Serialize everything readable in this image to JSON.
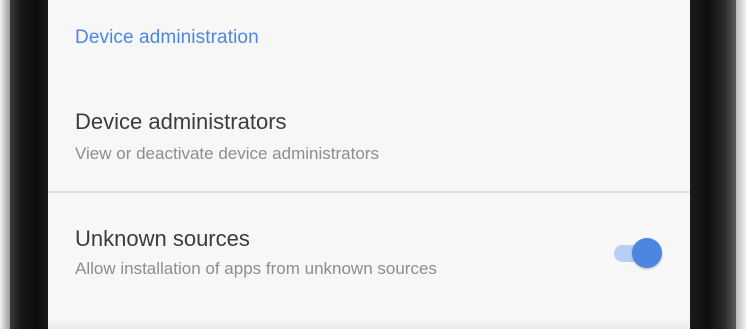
{
  "theme": {
    "accent_color": "#4d86e0",
    "switch_track_color": "#b8cff3",
    "title_color": "#3c3c3c",
    "summary_color": "#8d8d8d",
    "screen_background": "#f7f7f8"
  },
  "section": {
    "header": "Device administration"
  },
  "items": [
    {
      "title": "Device administrators",
      "summary": "View or deactivate device administrators"
    },
    {
      "title": "Unknown sources",
      "summary": "Allow installation of apps from unknown sources",
      "switch_on": true
    }
  ]
}
